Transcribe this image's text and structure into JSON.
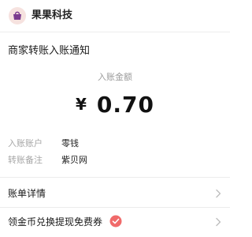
{
  "header": {
    "app_name": "果果科技",
    "logo_icon": "purple-bag-logo-icon",
    "logo_bg": "#f6e2df",
    "logo_color": "#7a3a8e"
  },
  "notice": {
    "title": "商家转账入账通知",
    "amount_label": "入账金额",
    "currency_symbol": "¥",
    "amount": "0.70"
  },
  "details": [
    {
      "key": "入账账户",
      "value": "零钱"
    },
    {
      "key": "转账备注",
      "value": "紫贝网"
    }
  ],
  "links": {
    "bill_details": "账单详情",
    "coupon": "领金币兑换提现免费券",
    "coupon_badge_icon": "red-coupon-badge-icon",
    "coupon_badge_color": "#f06a6a",
    "chevron_icon": "chevron-right-icon"
  }
}
